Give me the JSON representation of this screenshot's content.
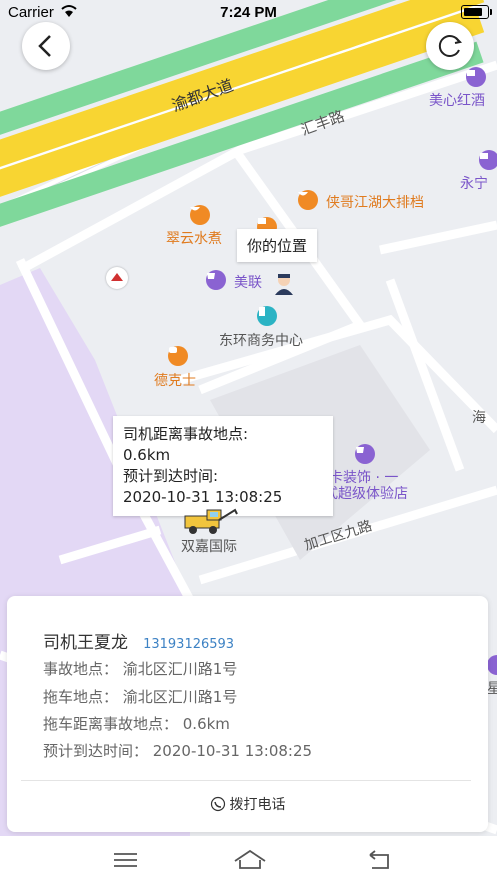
{
  "status_bar": {
    "carrier": "Carrier",
    "time": "7:24 PM"
  },
  "map": {
    "labels": {
      "road_main": "渝都大道",
      "road_huifeng": "汇丰路",
      "road_jiagong": "加工区九路",
      "hotel": "美心红酒",
      "yongning": "永宁",
      "xiage": "侠哥江湖大排档",
      "cuiyun": "翠云水煮",
      "meilian": "美联",
      "dongh": "东环商务中心",
      "dekeshi": "德克士",
      "tangka": "唐卡装饰 · 一",
      "tangka2": "站式超级体验店",
      "shuangjia": "双嘉国际",
      "hai": "海",
      "xing": "星"
    },
    "your_location_label": "你的位置",
    "info_popup": {
      "line1": "司机距离事故地点:",
      "line2": "0.6km",
      "line3": "预计到达时间:",
      "line4": "2020-10-31 13:08:25"
    }
  },
  "card": {
    "driver_name": "司机王夏龙",
    "driver_phone": "13193126593",
    "accident_location": "事故地点：  渝北区汇川路1号",
    "tow_location": "拖车地点：  渝北区汇川路1号",
    "tow_distance": "拖车距离事故地点：  0.6km",
    "eta": "预计到达时间：  2020-10-31 13:08:25",
    "call_label": "拨打电话"
  },
  "colors": {
    "road_yellow": "#f8d532",
    "road_green": "#7fd89b",
    "purple_area": "#e2d6f5",
    "phone_blue": "#3d82c4"
  }
}
